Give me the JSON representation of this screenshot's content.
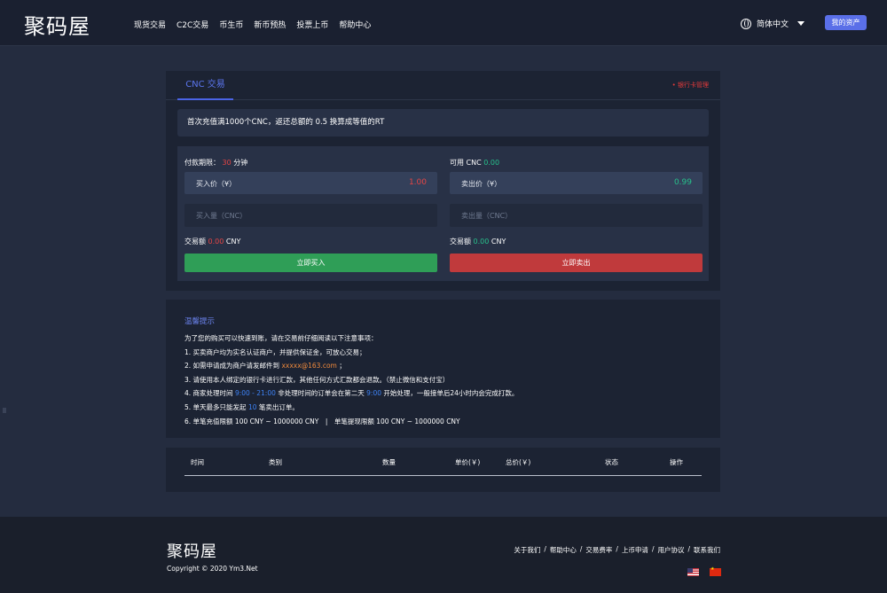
{
  "header": {
    "logo": "聚码屋",
    "nav": [
      "现货交易",
      "C2C交易",
      "币生币",
      "新币预热",
      "投票上币",
      "帮助中心"
    ],
    "language": "简体中文",
    "assets_button": "我的资产"
  },
  "trade": {
    "tab": "CNC 交易",
    "bank_link": "• 银行卡管理",
    "notice": "首次充值满1000个CNC，返还总额的 0.5 换算成等值的RT",
    "buy": {
      "deadline_label": "付款期限：",
      "deadline_value": "30",
      "deadline_unit": "分钟",
      "price_label": "买入价（¥）",
      "price_value": "1.00",
      "amount_placeholder": "买入量（CNC）",
      "total_label": "交易额",
      "total_value": "0.00",
      "total_unit": "CNY",
      "button": "立即买入"
    },
    "sell": {
      "available_label": "可用 CNC",
      "available_value": "0.00",
      "price_label": "卖出价（¥）",
      "price_value": "0.99",
      "amount_placeholder": "卖出量（CNC）",
      "total_label": "交易额",
      "total_value": "0.00",
      "total_unit": "CNY",
      "button": "立即卖出"
    },
    "colors": {
      "buy": "#2f9e57",
      "sell": "#c03a3c",
      "accent": "#5a6fe8"
    }
  },
  "tips": {
    "title": "温馨提示",
    "intro": "为了您的购买可以快速到账，请在交易前仔细阅读以下注意事项：",
    "l1": "1. 买卖商户均为实名认证商户，并提供保证金，可放心交易；",
    "l2_a": "2. 如需申请成为商户请发邮件到",
    "l2_email": "xxxxx@163.com",
    "l2_b": "；",
    "l3": "3. 请使用本人绑定的银行卡进行汇款，其他任何方式汇款都会退款。（禁止微信和支付宝）",
    "l4_a": "4. 商家处理时间",
    "l4_time": "9:00 - 21:00",
    "l4_b": "非处理时间的订单会在第二天",
    "l4_time2": "9:00",
    "l4_c": "开始处理，一般接单后24小时内会完成打款。",
    "l5_a": "5. 单天最多只能发起",
    "l5_num": "10",
    "l5_b": "笔卖出订单。",
    "l6": "6. 单笔充值限额 100 CNY ~ 1000000 CNY　|　单笔提现限额 100 CNY ~ 1000000 CNY"
  },
  "records": {
    "columns": [
      "时间",
      "类别",
      "数量",
      "单价(￥)",
      "总价(￥)",
      "状态",
      "操作"
    ]
  },
  "footer": {
    "logo": "聚码屋",
    "copyright": "Copyright © 2020 Ym3.Net",
    "links": [
      "关于我们",
      "帮助中心",
      "交易费率",
      "上币申请",
      "用户协议",
      "联系我们"
    ],
    "separator": "/"
  }
}
